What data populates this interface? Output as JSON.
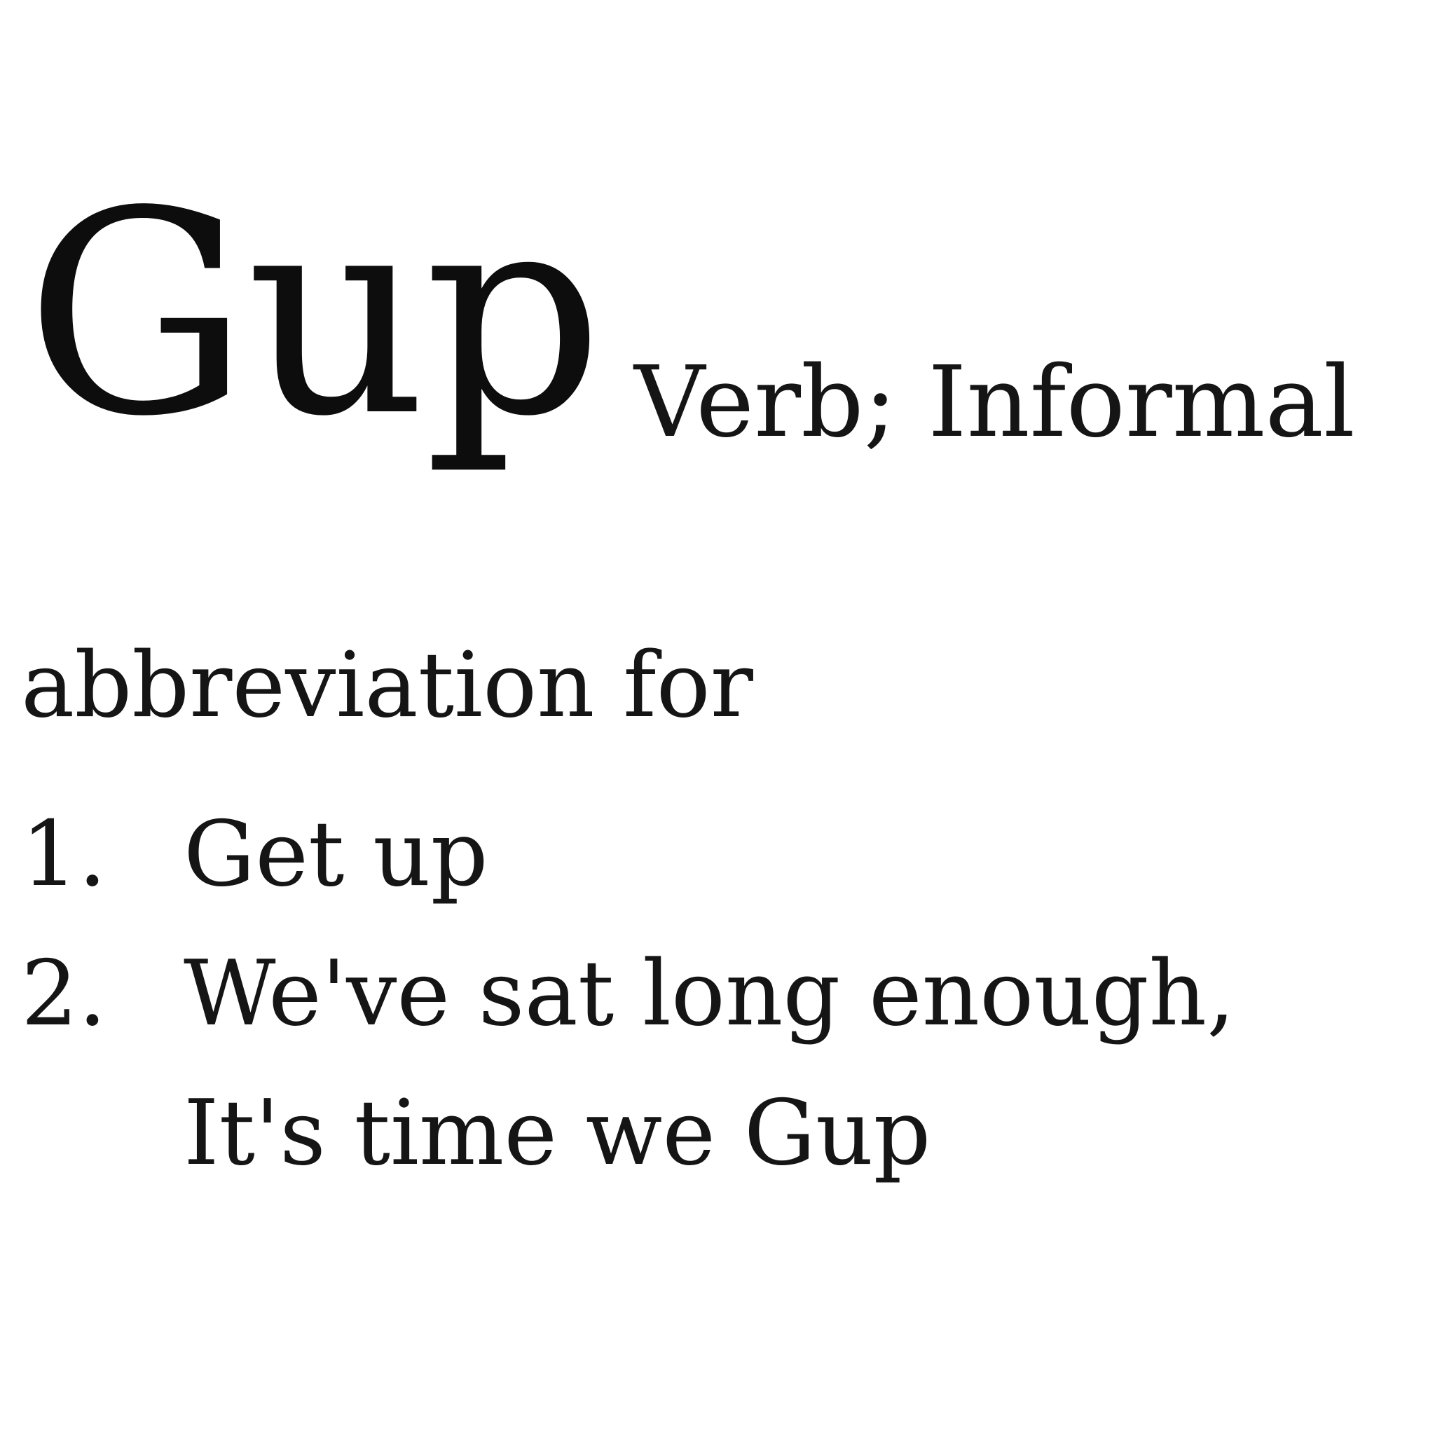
{
  "entry": {
    "headword": "Gup",
    "part_of_speech": "Verb; Informal"
  },
  "definition": {
    "intro": "abbreviation for",
    "items": [
      {
        "number": "1.",
        "lines": [
          "Get up"
        ]
      },
      {
        "number": "2.",
        "lines": [
          "We've sat long enough,",
          "It's time we Gup"
        ]
      }
    ]
  },
  "colors": {
    "background": "#ffffff",
    "text": "#111111"
  }
}
